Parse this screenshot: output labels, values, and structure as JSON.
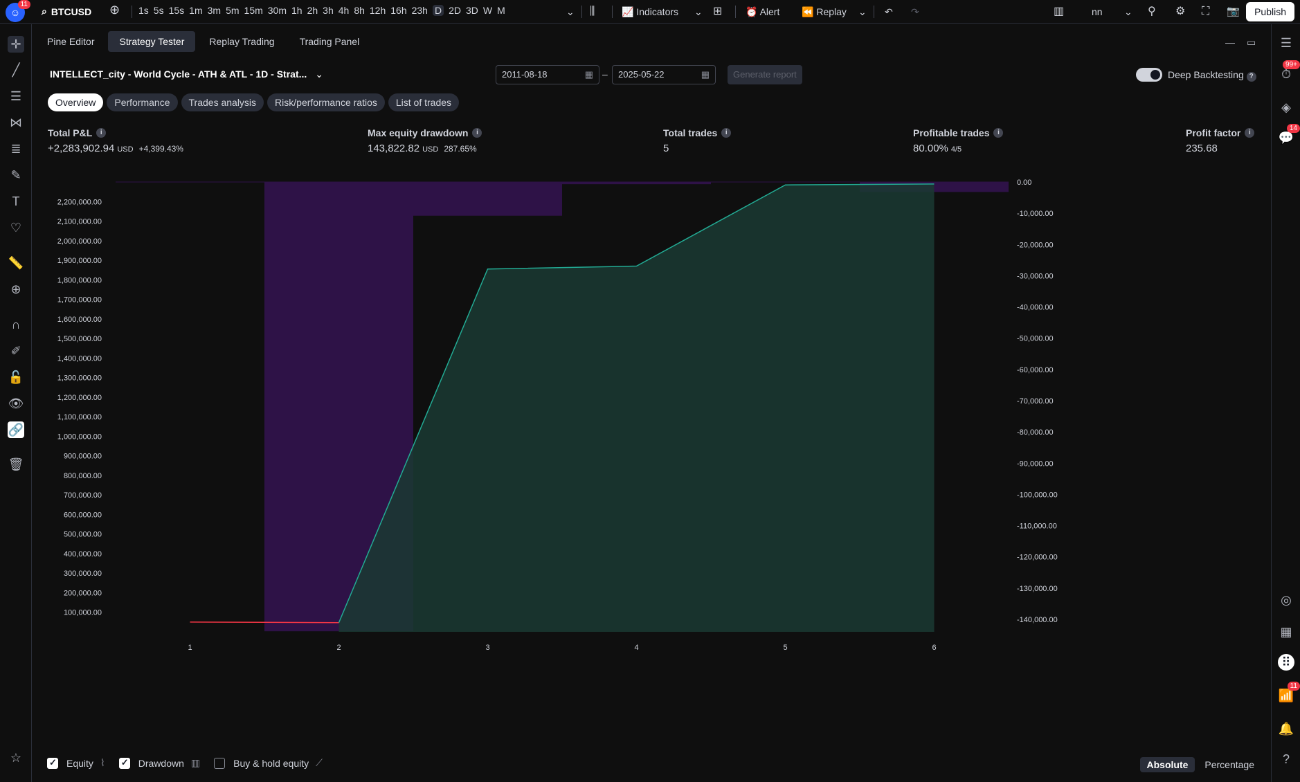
{
  "topbar": {
    "logo_badge": "11",
    "symbol": "BTCUSD",
    "timeframes": [
      "1s",
      "5s",
      "15s",
      "1m",
      "3m",
      "5m",
      "15m",
      "30m",
      "1h",
      "2h",
      "3h",
      "4h",
      "8h",
      "12h",
      "16h",
      "23h",
      "D",
      "2D",
      "3D",
      "W",
      "M"
    ],
    "active_timeframe": "D",
    "indicators_label": "Indicators",
    "alert_label": "Alert",
    "replay_label": "Replay",
    "layout_name": "nn",
    "publish_label": "Publish"
  },
  "panel": {
    "tabs": [
      "Pine Editor",
      "Strategy Tester",
      "Replay Trading",
      "Trading Panel"
    ],
    "active_tab": "Strategy Tester",
    "strategy_title": "INTELLECT_city - World Cycle - ATH & ATL - 1D - Strat...",
    "date_from": "2011-08-18",
    "date_to": "2025-05-22",
    "generate_report_label": "Generate report",
    "deep_backtesting_label": "Deep Backtesting",
    "subtabs": [
      "Overview",
      "Performance",
      "Trades analysis",
      "Risk/performance ratios",
      "List of trades"
    ],
    "active_subtab": "Overview"
  },
  "metrics": {
    "total_pnl": {
      "label": "Total P&L",
      "value": "+2,283,902.94",
      "unit": "USD",
      "pct": "+4,399.43%"
    },
    "max_drawdown": {
      "label": "Max equity drawdown",
      "value": "143,822.82",
      "unit": "USD",
      "pct": "287.65%"
    },
    "total_trades": {
      "label": "Total trades",
      "value": "5"
    },
    "profitable_trades": {
      "label": "Profitable trades",
      "value": "80.00%",
      "ratio": "4/5"
    },
    "profit_factor": {
      "label": "Profit factor",
      "value": "235.68"
    }
  },
  "chart_data": {
    "type": "area",
    "x": [
      1,
      2,
      3,
      4,
      5,
      6
    ],
    "series": [
      {
        "name": "Equity",
        "values": [
          50000,
          47000,
          1855000,
          1870000,
          2285000,
          2290000
        ]
      },
      {
        "name": "Drawdown",
        "values": [
          null,
          -143822.82,
          -10800,
          -700,
          null,
          -3200
        ]
      }
    ],
    "equity_axis": {
      "ticks": [
        100000,
        200000,
        300000,
        400000,
        500000,
        600000,
        700000,
        800000,
        900000,
        1000000,
        1100000,
        1200000,
        1300000,
        1400000,
        1500000,
        1600000,
        1700000,
        1800000,
        1900000,
        2000000,
        2100000,
        2200000
      ],
      "labels": [
        "100,000.00",
        "200,000.00",
        "300,000.00",
        "400,000.00",
        "500,000.00",
        "600,000.00",
        "700,000.00",
        "800,000.00",
        "900,000.00",
        "1,000,000.00",
        "1,100,000.00",
        "1,200,000.00",
        "1,300,000.00",
        "1,400,000.00",
        "1,500,000.00",
        "1,600,000.00",
        "1,700,000.00",
        "1,800,000.00",
        "1,900,000.00",
        "2,000,000.00",
        "2,100,000.00",
        "2,200,000.00"
      ]
    },
    "drawdown_axis": {
      "ticks": [
        0,
        -10000,
        -20000,
        -30000,
        -40000,
        -50000,
        -60000,
        -70000,
        -80000,
        -90000,
        -100000,
        -110000,
        -120000,
        -130000,
        -140000
      ],
      "labels": [
        "0.00",
        "-10,000.00",
        "-20,000.00",
        "-30,000.00",
        "-40,000.00",
        "-50,000.00",
        "-60,000.00",
        "-70,000.00",
        "-80,000.00",
        "-90,000.00",
        "-100,000.00",
        "-110,000.00",
        "-120,000.00",
        "-130,000.00",
        "-140,000.00"
      ]
    },
    "x_labels": [
      "1",
      "2",
      "3",
      "4",
      "5",
      "6"
    ],
    "colors": {
      "equity": "#22ab94",
      "equity_fill": "#1a3a33",
      "drawdown": "#2e1247",
      "loss_line": "#f23645"
    }
  },
  "legend": {
    "equity_label": "Equity",
    "drawdown_label": "Drawdown",
    "buyhold_label": "Buy & hold equity",
    "equity_checked": true,
    "drawdown_checked": true,
    "buyhold_checked": false
  },
  "modes": {
    "absolute": "Absolute",
    "percentage": "Percentage",
    "active": "Absolute"
  },
  "rightbar": {
    "badge1": "99+",
    "badge2": "14",
    "badge3": "11"
  }
}
